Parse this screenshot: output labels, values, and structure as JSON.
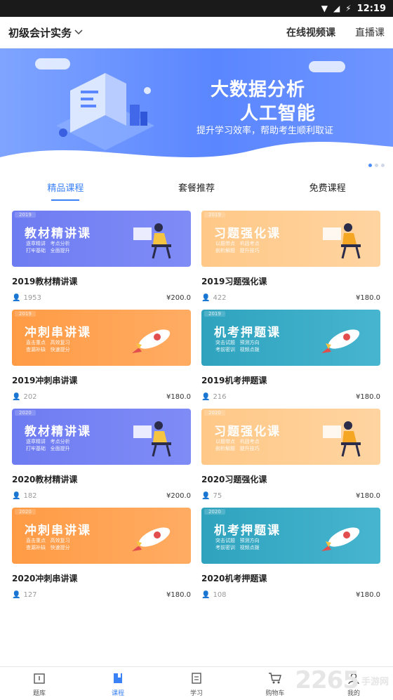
{
  "status_bar": {
    "battery": "⚡",
    "time": "12:19"
  },
  "header": {
    "subject": "初级会计实务",
    "links": [
      "在线视频课",
      "直播课"
    ]
  },
  "banner": {
    "title1": "大数据分析",
    "title2": "人工智能",
    "subtitle": "提升学习效率，帮助考生顺利取证"
  },
  "tabs": [
    "精品课程",
    "套餐推荐",
    "免费课程"
  ],
  "courses": [
    {
      "title": "2019教材精讲课",
      "students": "1953",
      "price": "¥200.0",
      "banner_big": "教材精讲课",
      "banner_small": "逐章精讲   考点分析\n打牢基础   全面提升",
      "year": "2019"
    },
    {
      "title": "2019习题强化课",
      "students": "422",
      "price": "¥180.0",
      "banner_big": "习题强化课",
      "banner_small": "以题带点   巩固考点\n剖析解题   提升技巧",
      "year": "2019"
    },
    {
      "title": "2019冲刺串讲课",
      "students": "202",
      "price": "¥180.0",
      "banner_big": "冲刺串讲课",
      "banner_small": "直击重点   高效复习\n查漏补缺   快速提分",
      "year": "2019"
    },
    {
      "title": "2019机考押题课",
      "students": "216",
      "price": "¥180.0",
      "banner_big": "机考押题课",
      "banner_small": "突击试题   预测方向\n考前密训   视频点拨",
      "year": "2019"
    },
    {
      "title": "2020教材精讲课",
      "students": "182",
      "price": "¥200.0",
      "banner_big": "教材精讲课",
      "banner_small": "逐章精讲   考点分析\n打牢基础   全面提升",
      "year": "2020"
    },
    {
      "title": "2020习题强化课",
      "students": "75",
      "price": "¥180.0",
      "banner_big": "习题强化课",
      "banner_small": "以题带点   巩固考点\n剖析解题   提升技巧",
      "year": "2020"
    },
    {
      "title": "2020冲刺串讲课",
      "students": "127",
      "price": "¥180.0",
      "banner_big": "冲刺串讲课",
      "banner_small": "直击重点   高效复习\n查漏补缺   快速提分",
      "year": "2020"
    },
    {
      "title": "2020机考押题课",
      "students": "108",
      "price": "¥180.0",
      "banner_big": "机考押题课",
      "banner_small": "突击试题   预测方向\n考前密训   视频点拨",
      "year": "2020"
    }
  ],
  "bottom_nav": [
    "题库",
    "课程",
    "学习",
    "购物车",
    "我的"
  ],
  "watermark": {
    "num": "2265",
    "text": "手游网"
  },
  "colors": {
    "accent": "#3b82f6"
  }
}
